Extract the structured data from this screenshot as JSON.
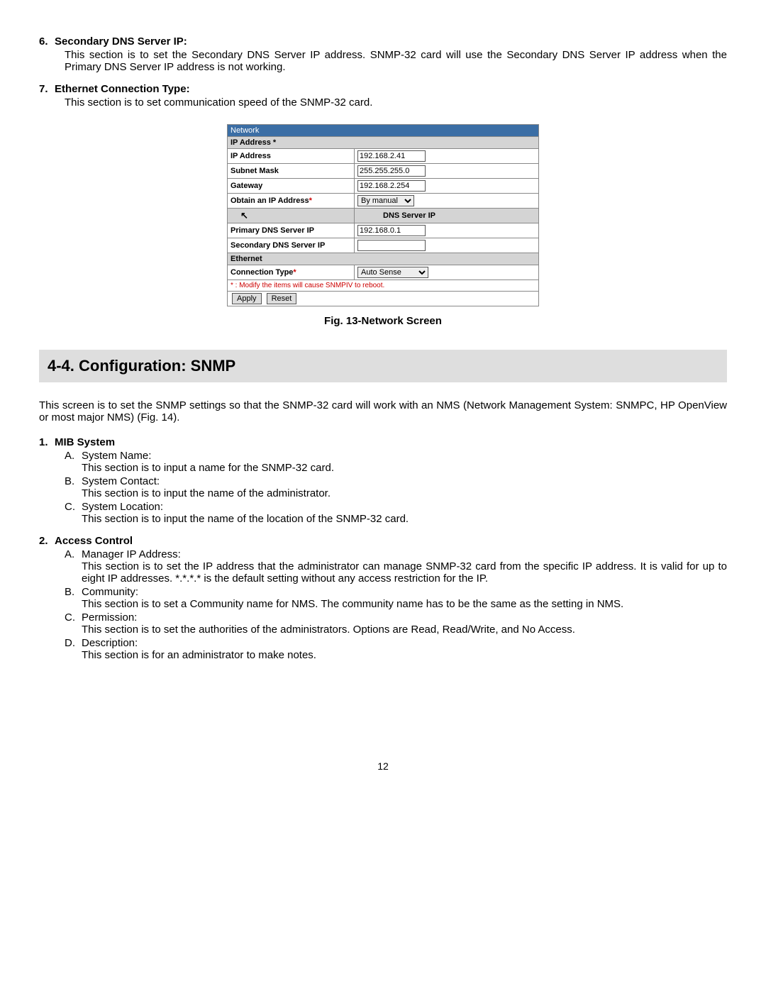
{
  "list1": {
    "i6": {
      "num": "6.",
      "title": "Secondary DNS Server IP:",
      "body": "This section is to set the Secondary DNS Server IP address.  SNMP-32 card will use the Secondary DNS Server IP address when the Primary DNS Server IP address is not working."
    },
    "i7": {
      "num": "7.",
      "title": "Ethernet Connection Type:",
      "body": "This section is to set communication speed of the SNMP-32 card."
    }
  },
  "table": {
    "title": "Network",
    "sec1": "IP Address *",
    "r_ip_lbl": "IP Address",
    "r_ip_val": "192.168.2.41",
    "r_sm_lbl": "Subnet Mask",
    "r_sm_val": "255.255.255.0",
    "r_gw_lbl": "Gateway",
    "r_gw_val": "192.168.2.254",
    "r_ob_lbl": "Obtain an IP Address",
    "r_ob_val": "By manual",
    "sec2": "DNS Server IP",
    "r_pd_lbl": "Primary DNS Server IP",
    "r_pd_val": "192.168.0.1",
    "r_sd_lbl": "Secondary DNS Server IP",
    "r_sd_val": "",
    "sec3": "Ethernet",
    "r_ct_lbl": "Connection Type",
    "r_ct_val": "Auto Sense",
    "warn": "* : Modify the items will cause SNMPIV to reboot.",
    "btn_apply": "Apply",
    "btn_reset": "Reset"
  },
  "fig_caption": "Fig. 13-Network Screen",
  "section_heading": "4-4.  Configuration: SNMP",
  "snmp_intro": "This screen is to set the SNMP settings so that the SNMP-32 card will work with an NMS (Network Management System: SNMPC, HP OpenView or most major NMS) (Fig. 14).",
  "list2": {
    "i1": {
      "num": "1.",
      "title": "MIB System",
      "a_l": "A.",
      "a_t": "System Name:",
      "a_b": "This section is to input a name for the SNMP-32 card.",
      "b_l": "B.",
      "b_t": "System Contact:",
      "b_b": "This section is to input the name of the administrator.",
      "c_l": "C.",
      "c_t": "System Location:",
      "c_b": "This section is to input the name of the location of the SNMP-32 card."
    },
    "i2": {
      "num": "2.",
      "title": "Access Control",
      "a_l": "A.",
      "a_t": "Manager IP Address:",
      "a_b": "This section is to set the IP address that the administrator can manage SNMP-32 card from the specific IP address.  It is valid for up to eight IP addresses.  *.*.*.* is the default setting without any access restriction for the IP.",
      "b_l": "B.",
      "b_t": "Community:",
      "b_b": "This section is to set a Community name for NMS.  The community name has to be the same as the setting in NMS.",
      "c_l": "C.",
      "c_t": "Permission:",
      "c_b": "This section is to set the authorities of the administrators.  Options are Read, Read/Write, and No Access.",
      "d_l": "D.",
      "d_t": "Description:",
      "d_b": "This section is for an administrator to make notes."
    }
  },
  "page_number": "12",
  "star": "*"
}
